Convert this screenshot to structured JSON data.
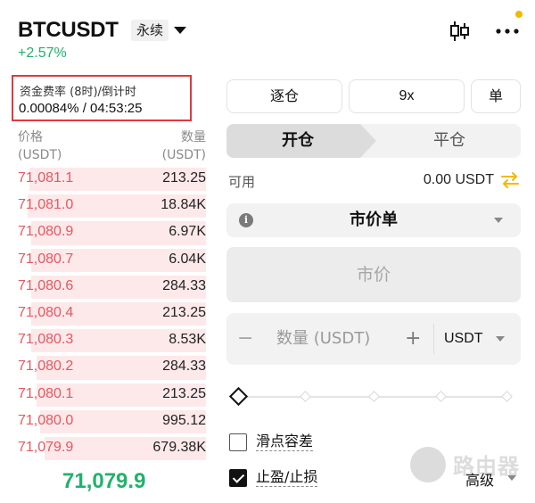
{
  "header": {
    "symbol": "BTCUSDT",
    "type_tag": "永续",
    "change": "+2.57%"
  },
  "funding": {
    "label": "资金费率 (8时)/倒计时",
    "value": "0.00084% / 04:53:25"
  },
  "orderbook": {
    "price_header": [
      "价格",
      "(USDT)"
    ],
    "qty_header": [
      "数量",
      "(USDT)"
    ],
    "rows": [
      {
        "price": "71,081.1",
        "qty": "213.25",
        "depth": 0.94
      },
      {
        "price": "71,081.0",
        "qty": "18.84K",
        "depth": 0.95
      },
      {
        "price": "71,080.9",
        "qty": "6.97K",
        "depth": 0.93
      },
      {
        "price": "71,080.7",
        "qty": "6.04K",
        "depth": 0.93
      },
      {
        "price": "71,080.6",
        "qty": "284.33",
        "depth": 0.93
      },
      {
        "price": "71,080.4",
        "qty": "213.25",
        "depth": 0.93
      },
      {
        "price": "71,080.3",
        "qty": "8.53K",
        "depth": 0.93
      },
      {
        "price": "71,080.2",
        "qty": "284.33",
        "depth": 0.9
      },
      {
        "price": "71,080.1",
        "qty": "213.25",
        "depth": 0.9
      },
      {
        "price": "71,080.0",
        "qty": "995.12",
        "depth": 0.88
      },
      {
        "price": "71,079.9",
        "qty": "679.38K",
        "depth": 0.86
      }
    ],
    "last_price": "71,079.9"
  },
  "controls": {
    "margin_mode": "逐仓",
    "leverage": "9x",
    "unit_button": "单",
    "tab_open": "开仓",
    "tab_close": "平仓",
    "available_label": "可用",
    "available_value": "0.00 USDT",
    "order_type": "市价单",
    "price_placeholder": "市价",
    "qty_minus": "−",
    "qty_placeholder": "数量 (USDT)",
    "qty_plus": "+",
    "qty_unit": "USDT",
    "slippage_label": "滑点容差",
    "tpsl_label": "止盈/止损",
    "advanced_label": "高级"
  },
  "watermark": {
    "text": "路由器"
  },
  "colors": {
    "positive": "#20b26c",
    "ask": "#e9565f",
    "ask_depth": "#fde9ea",
    "highlight_border": "#e0393e",
    "accent_swap": "#f5b800"
  },
  "icons": [
    "candlestick-icon",
    "more-icon",
    "swap-icon",
    "info-icon",
    "chevron-down-icon"
  ]
}
